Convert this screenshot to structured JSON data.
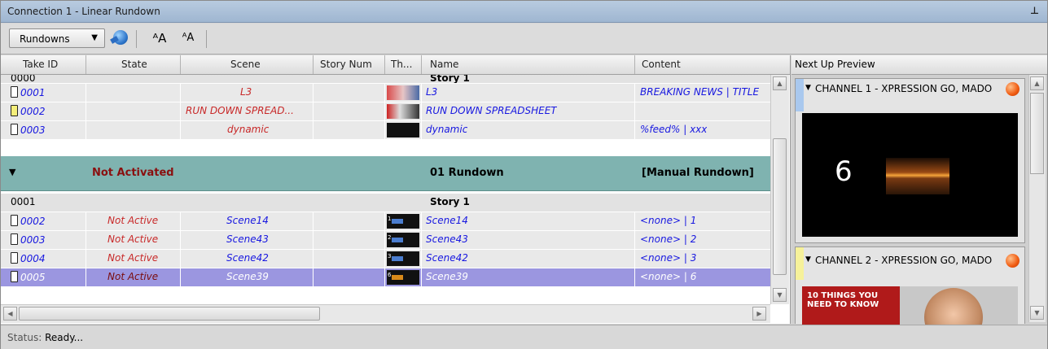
{
  "window": {
    "title": "Connection 1 - Linear Rundown",
    "pin_icon": "pin-icon"
  },
  "toolbar": {
    "rundowns_label": "Rundowns",
    "font_increase": "ᴬA",
    "font_decrease": "ᴬA"
  },
  "columns": [
    "Take ID",
    "State",
    "Scene",
    "Story Num",
    "Th...",
    "Name",
    "Content"
  ],
  "rows_top": {
    "partial_id": "0000",
    "partial_name": "Story 1",
    "takes": [
      {
        "id": "0001",
        "state": "",
        "scene": "L3",
        "name": "L3",
        "content": "BREAKING NEWS | TITLE",
        "marker": "white"
      },
      {
        "id": "0002",
        "state": "",
        "scene": "RUN DOWN SPREAD...",
        "name": "RUN DOWN SPREADSHEET",
        "content": "",
        "marker": "yellow"
      },
      {
        "id": "0003",
        "state": "",
        "scene": "dynamic",
        "name": "dynamic",
        "content": "%feed% | xxx",
        "marker": "white"
      }
    ]
  },
  "group": {
    "state": "Not Activated",
    "name": "01 Rundown",
    "content": "[Manual Rundown]"
  },
  "story": {
    "id": "0001",
    "name": "Story 1"
  },
  "takes": [
    {
      "id": "0002",
      "state": "Not Active",
      "scene": "Scene14",
      "name": "Scene14",
      "content": "<none> | 1",
      "thumb_num": "1"
    },
    {
      "id": "0003",
      "state": "Not Active",
      "scene": "Scene43",
      "name": "Scene43",
      "content": "<none> | 2",
      "thumb_num": "2"
    },
    {
      "id": "0004",
      "state": "Not Active",
      "scene": "Scene42",
      "name": "Scene42",
      "content": "<none> | 3",
      "thumb_num": "3"
    },
    {
      "id": "0005",
      "state": "Not Active",
      "scene": "Scene39",
      "name": "Scene39",
      "content": "<none> | 6",
      "thumb_num": "6"
    }
  ],
  "preview": {
    "title": "Next Up Preview",
    "channel1": {
      "name": "CHANNEL 1 - XPRESSION GO, MADO",
      "number": "6",
      "tab_color": "#a9c8ee"
    },
    "channel2": {
      "name": "CHANNEL 2 - XPRESSION GO, MADO",
      "banner_text": "10 THINGS YOU NEED TO KNOW",
      "tab_color": "#f6f19a"
    }
  },
  "status": {
    "label": "Status:",
    "value": "Ready..."
  }
}
